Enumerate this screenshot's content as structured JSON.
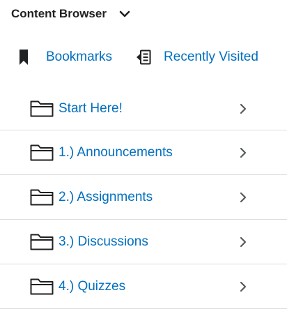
{
  "header": {
    "title": "Content Browser",
    "toggle_icon": "chevron-down-icon"
  },
  "shortcuts": [
    {
      "label": "Bookmarks",
      "icon": "bookmark-icon"
    },
    {
      "label": "Recently Visited",
      "icon": "recently-visited-icon"
    }
  ],
  "modules": [
    {
      "label": "Start Here!",
      "icon": "folder-icon"
    },
    {
      "label": "1.) Announcements",
      "icon": "folder-icon"
    },
    {
      "label": "2.) Assignments",
      "icon": "folder-icon"
    },
    {
      "label": "3.) Discussions",
      "icon": "folder-icon"
    },
    {
      "label": "4.) Quizzes",
      "icon": "folder-icon"
    }
  ],
  "colors": {
    "link": "#006fbf",
    "title": "#202122",
    "icon": "#202122",
    "chevron": "#565a5c",
    "divider": "#d8dcde"
  }
}
